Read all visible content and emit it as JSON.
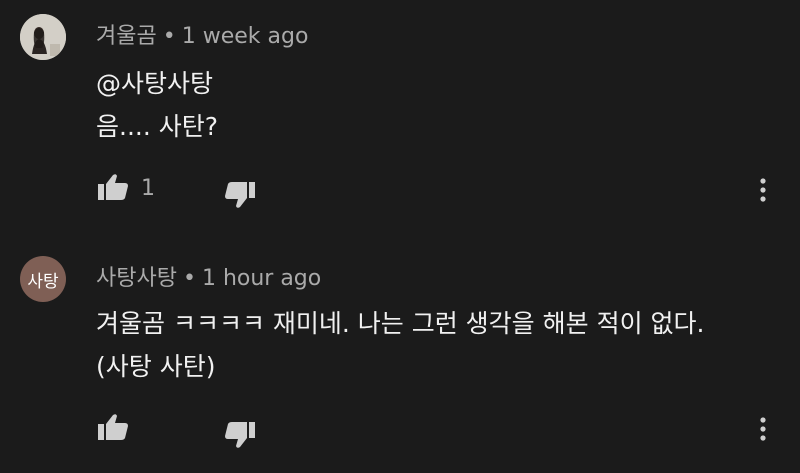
{
  "comments": [
    {
      "author": "겨울곰",
      "separator": "•",
      "time": "1 week ago",
      "avatar_icon": "user-photo-icon",
      "lines": [
        "@사탕사탕",
        "음.... 사탄?"
      ],
      "like_count": "1"
    },
    {
      "author": "사탕사탕",
      "separator": "•",
      "time": "1 hour ago",
      "avatar_initial": "사탕",
      "avatar_color": "#7f5f55",
      "lines": [
        "겨울곰 ㅋㅋㅋㅋ 재미네. 나는 그런 생각을 해본 적이 없다.",
        "(사탕 사탄)"
      ],
      "like_count": ""
    }
  ],
  "colors": {
    "background": "#1b1b1b",
    "text_primary": "#f1f1f1",
    "text_secondary": "#aaaaaa",
    "icon": "#cfcfcf"
  }
}
